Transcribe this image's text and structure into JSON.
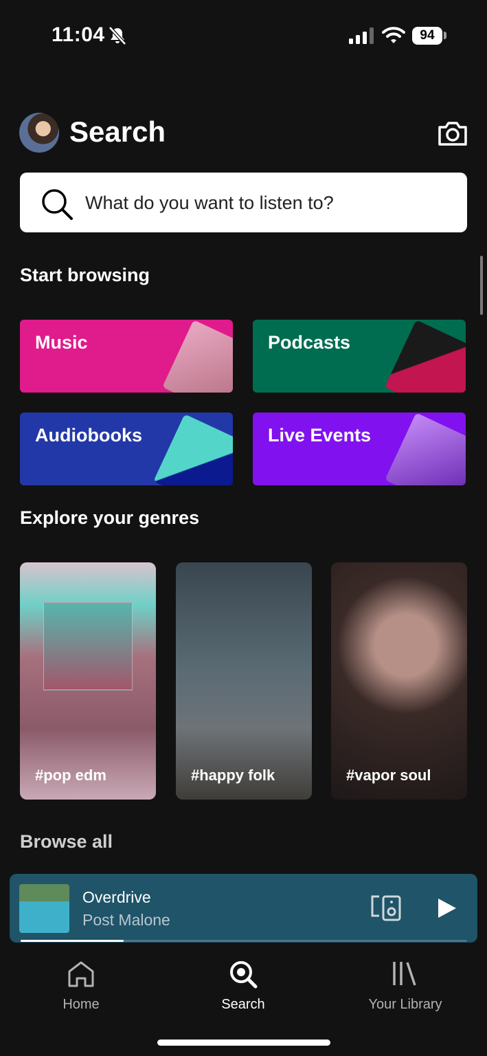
{
  "status_bar": {
    "time": "11:04",
    "battery": "94"
  },
  "header": {
    "title": "Search"
  },
  "search": {
    "placeholder": "What do you want to listen to?"
  },
  "start_browsing": {
    "heading": "Start browsing",
    "tiles": [
      {
        "label": "Music",
        "color": "#e01b8c"
      },
      {
        "label": "Podcasts",
        "color": "#006d50"
      },
      {
        "label": "Audiobooks",
        "color": "#2338a8"
      },
      {
        "label": "Live Events",
        "color": "#8112ef"
      }
    ]
  },
  "genres": {
    "heading": "Explore your genres",
    "items": [
      {
        "label": "#pop edm"
      },
      {
        "label": "#happy folk"
      },
      {
        "label": "#vapor soul"
      }
    ]
  },
  "browse_all": {
    "heading": "Browse all"
  },
  "player": {
    "track": "Overdrive",
    "artist": "Post Malone",
    "progress": 0.23,
    "color": "#1f5469"
  },
  "nav": {
    "items": [
      {
        "label": "Home",
        "icon": "home-icon"
      },
      {
        "label": "Search",
        "icon": "search-icon"
      },
      {
        "label": "Your Library",
        "icon": "library-icon"
      }
    ]
  }
}
